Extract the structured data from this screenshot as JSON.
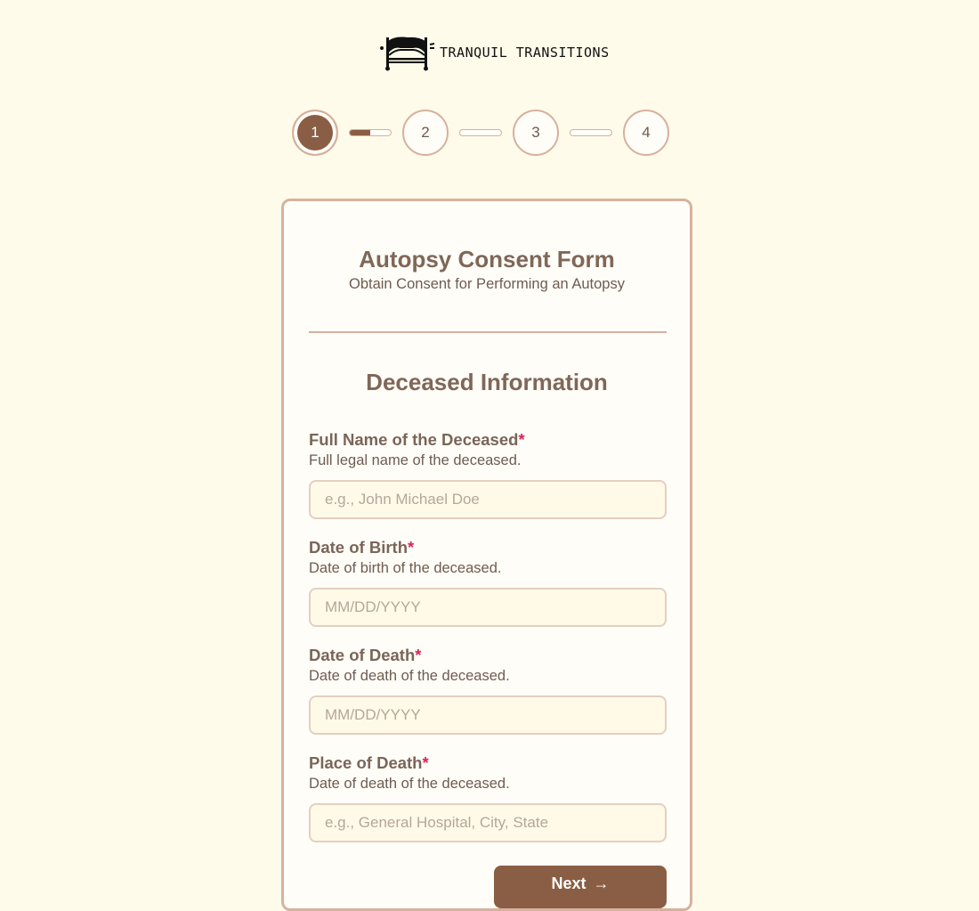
{
  "brand": {
    "name": "TRANQUIL TRANSITIONS",
    "logo_icon": "bed-icon"
  },
  "stepper": {
    "current_step": 1,
    "steps": [
      {
        "label": "1",
        "state": "active"
      },
      {
        "label": "2",
        "state": "inactive"
      },
      {
        "label": "3",
        "state": "inactive"
      },
      {
        "label": "4",
        "state": "inactive"
      }
    ],
    "connector_progress": [
      0.5,
      0,
      0
    ],
    "colors": {
      "active": "#8a5e44",
      "border": "#d7b09c"
    }
  },
  "form": {
    "title": "Autopsy Consent Form",
    "subtitle": "Obtain Consent for Performing an Autopsy",
    "section_title": "Deceased Information",
    "required_marker": "*",
    "fields": [
      {
        "label": "Full Name of the Deceased",
        "description": "Full legal name of the deceased.",
        "placeholder": "e.g., John Michael Doe",
        "value": ""
      },
      {
        "label": "Date of Birth",
        "description": "Date of birth of the deceased.",
        "placeholder": "MM/DD/YYYY",
        "value": ""
      },
      {
        "label": "Date of Death",
        "description": "Date of death of the deceased.",
        "placeholder": "MM/DD/YYYY",
        "value": ""
      },
      {
        "label": "Place of Death",
        "description": "Date of death of the deceased.",
        "placeholder": "e.g., General Hospital, City, State",
        "value": ""
      }
    ],
    "next_button": {
      "label": "Next",
      "icon": "arrow-right-icon"
    }
  },
  "colors": {
    "background": "#fffbea",
    "card": "#fffdf8",
    "accent": "#8a5e44",
    "required": "#d6245e"
  }
}
